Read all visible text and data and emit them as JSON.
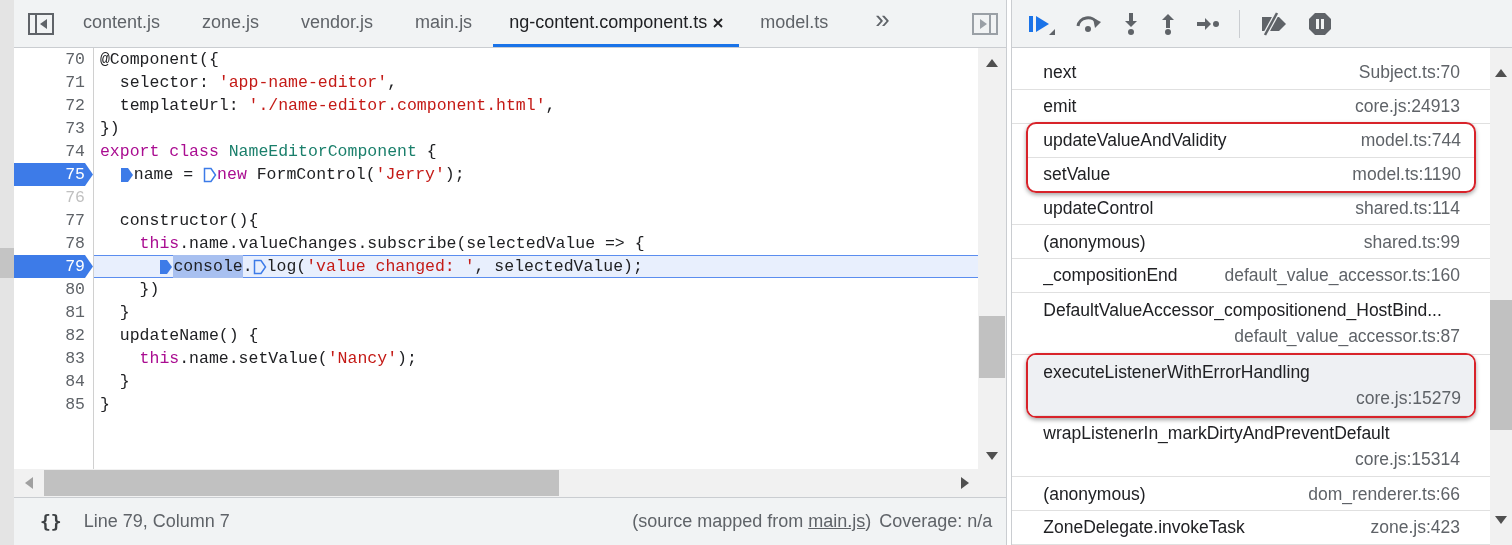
{
  "tabs": [
    {
      "label": "content.js",
      "selected": false
    },
    {
      "label": "zone.js",
      "selected": false
    },
    {
      "label": "vendor.js",
      "selected": false
    },
    {
      "label": "main.js",
      "selected": false
    },
    {
      "label": "ng-content.component.ts",
      "selected": true
    },
    {
      "label": "model.ts",
      "selected": false
    }
  ],
  "more_tabs": "»",
  "code_lines": [
    {
      "number": "70",
      "breakable": true,
      "breakpoint": false,
      "current": false,
      "tokens": [
        {
          "kind": "plain",
          "text": "@Component({"
        }
      ]
    },
    {
      "number": "71",
      "breakable": true,
      "breakpoint": false,
      "current": false,
      "tokens": [
        {
          "kind": "plain",
          "text": "  selector: "
        },
        {
          "kind": "str",
          "text": "'app-name-editor'"
        },
        {
          "kind": "plain",
          "text": ","
        }
      ]
    },
    {
      "number": "72",
      "breakable": true,
      "breakpoint": false,
      "current": false,
      "tokens": [
        {
          "kind": "plain",
          "text": "  templateUrl: "
        },
        {
          "kind": "str",
          "text": "'./name-editor.component.html'"
        },
        {
          "kind": "plain",
          "text": ","
        }
      ]
    },
    {
      "number": "73",
      "breakable": true,
      "breakpoint": false,
      "current": false,
      "tokens": [
        {
          "kind": "plain",
          "text": "})"
        }
      ]
    },
    {
      "number": "74",
      "breakable": true,
      "breakpoint": false,
      "current": false,
      "tokens": [
        {
          "kind": "kw",
          "text": "export class "
        },
        {
          "kind": "cls",
          "text": "NameEditorComponent"
        },
        {
          "kind": "plain",
          "text": " {"
        }
      ]
    },
    {
      "number": "75",
      "breakpoint": true,
      "current": false,
      "tokens": [
        {
          "kind": "plain",
          "text": "  name = ",
          "marker_active": true
        },
        {
          "kind": "kw",
          "text": "new",
          "marker_active": false
        },
        {
          "kind": "plain",
          "text": " FormControl("
        },
        {
          "kind": "str",
          "text": "'Jerry'"
        },
        {
          "kind": "plain",
          "text": ");"
        }
      ]
    },
    {
      "number": "76",
      "breakable": false,
      "breakpoint": false,
      "current": false
    },
    {
      "number": "77",
      "breakable": true,
      "breakpoint": false,
      "current": false,
      "tokens": [
        {
          "kind": "plain",
          "text": "  constructor(){"
        }
      ]
    },
    {
      "number": "78",
      "breakable": true,
      "breakpoint": false,
      "current": false,
      "tokens": [
        {
          "kind": "kw",
          "text": "    this"
        },
        {
          "kind": "plain",
          "text": ".name.valueChanges.subscribe(selectedValue => {"
        }
      ]
    },
    {
      "number": "79",
      "breakpoint": true,
      "current": true,
      "tokens": [
        {
          "kind": "sel",
          "text": "      console",
          "marker_active": true
        },
        {
          "kind": "plain",
          "text": "."
        },
        {
          "kind": "plain",
          "text": "log(",
          "marker_active": false
        },
        {
          "kind": "str",
          "text": "'value changed: '"
        },
        {
          "kind": "plain",
          "text": ", selectedValue);"
        }
      ]
    },
    {
      "number": "80",
      "breakable": true,
      "breakpoint": false,
      "current": false,
      "tokens": [
        {
          "kind": "plain",
          "text": "    })"
        }
      ]
    },
    {
      "number": "81",
      "breakable": true,
      "breakpoint": false,
      "current": false,
      "tokens": [
        {
          "kind": "plain",
          "text": "  }"
        }
      ]
    },
    {
      "number": "82",
      "breakable": true,
      "breakpoint": false,
      "current": false,
      "tokens": [
        {
          "kind": "plain",
          "text": "  updateName() {"
        }
      ]
    },
    {
      "number": "83",
      "breakable": true,
      "breakpoint": false,
      "current": false,
      "tokens": [
        {
          "kind": "kw",
          "text": "    this"
        },
        {
          "kind": "plain",
          "text": ".name.setValue("
        },
        {
          "kind": "str",
          "text": "'Nancy'"
        },
        {
          "kind": "plain",
          "text": ");"
        }
      ]
    },
    {
      "number": "84",
      "breakable": true,
      "breakpoint": false,
      "current": false,
      "tokens": [
        {
          "kind": "plain",
          "text": "  }"
        }
      ]
    },
    {
      "number": "85",
      "breakable": true,
      "breakpoint": false,
      "current": false,
      "tokens": [
        {
          "kind": "plain",
          "text": "}"
        }
      ]
    }
  ],
  "status_bar": {
    "format_icon": "{}",
    "position": "Line 79, Column 7",
    "source_prefix": "(source mapped from ",
    "source_link": "main.js",
    "source_suffix": ")",
    "coverage": "Coverage: n/a"
  },
  "call_stack": [
    {
      "function": "next",
      "location": "Subject.ts:70",
      "annotated": false,
      "selected": false,
      "wrapped": false
    },
    {
      "function": "emit",
      "location": "core.js:24913",
      "annotated": false,
      "selected": false,
      "wrapped": false
    },
    {
      "function": "updateValueAndValidity",
      "location": "model.ts:744",
      "annotated": true,
      "selected": false,
      "wrapped": false
    },
    {
      "function": "setValue",
      "location": "model.ts:1190",
      "annotated": true,
      "selected": false,
      "wrapped": false
    },
    {
      "function": "updateControl",
      "location": "shared.ts:114",
      "annotated": false,
      "selected": false,
      "wrapped": false
    },
    {
      "function": "(anonymous)",
      "location": "shared.ts:99",
      "annotated": false,
      "selected": false,
      "wrapped": false
    },
    {
      "function": "_compositionEnd",
      "location": "default_value_accessor.ts:160",
      "annotated": false,
      "selected": false,
      "wrapped": false
    },
    {
      "function": "DefaultValueAccessor_compositionend_HostBind...",
      "location": "default_value_accessor.ts:87",
      "annotated": false,
      "selected": false,
      "wrapped": true
    },
    {
      "function": "executeListenerWithErrorHandling",
      "location": "core.js:15279",
      "annotated": true,
      "selected": true,
      "wrapped": true
    },
    {
      "function": "wrapListenerIn_markDirtyAndPreventDefault",
      "location": "core.js:15314",
      "annotated": false,
      "selected": false,
      "wrapped": true
    },
    {
      "function": "(anonymous)",
      "location": "dom_renderer.ts:66",
      "annotated": false,
      "selected": false,
      "wrapped": false
    },
    {
      "function": "ZoneDelegate.invokeTask",
      "location": "zone.js:423",
      "annotated": false,
      "selected": false,
      "wrapped": false
    }
  ]
}
